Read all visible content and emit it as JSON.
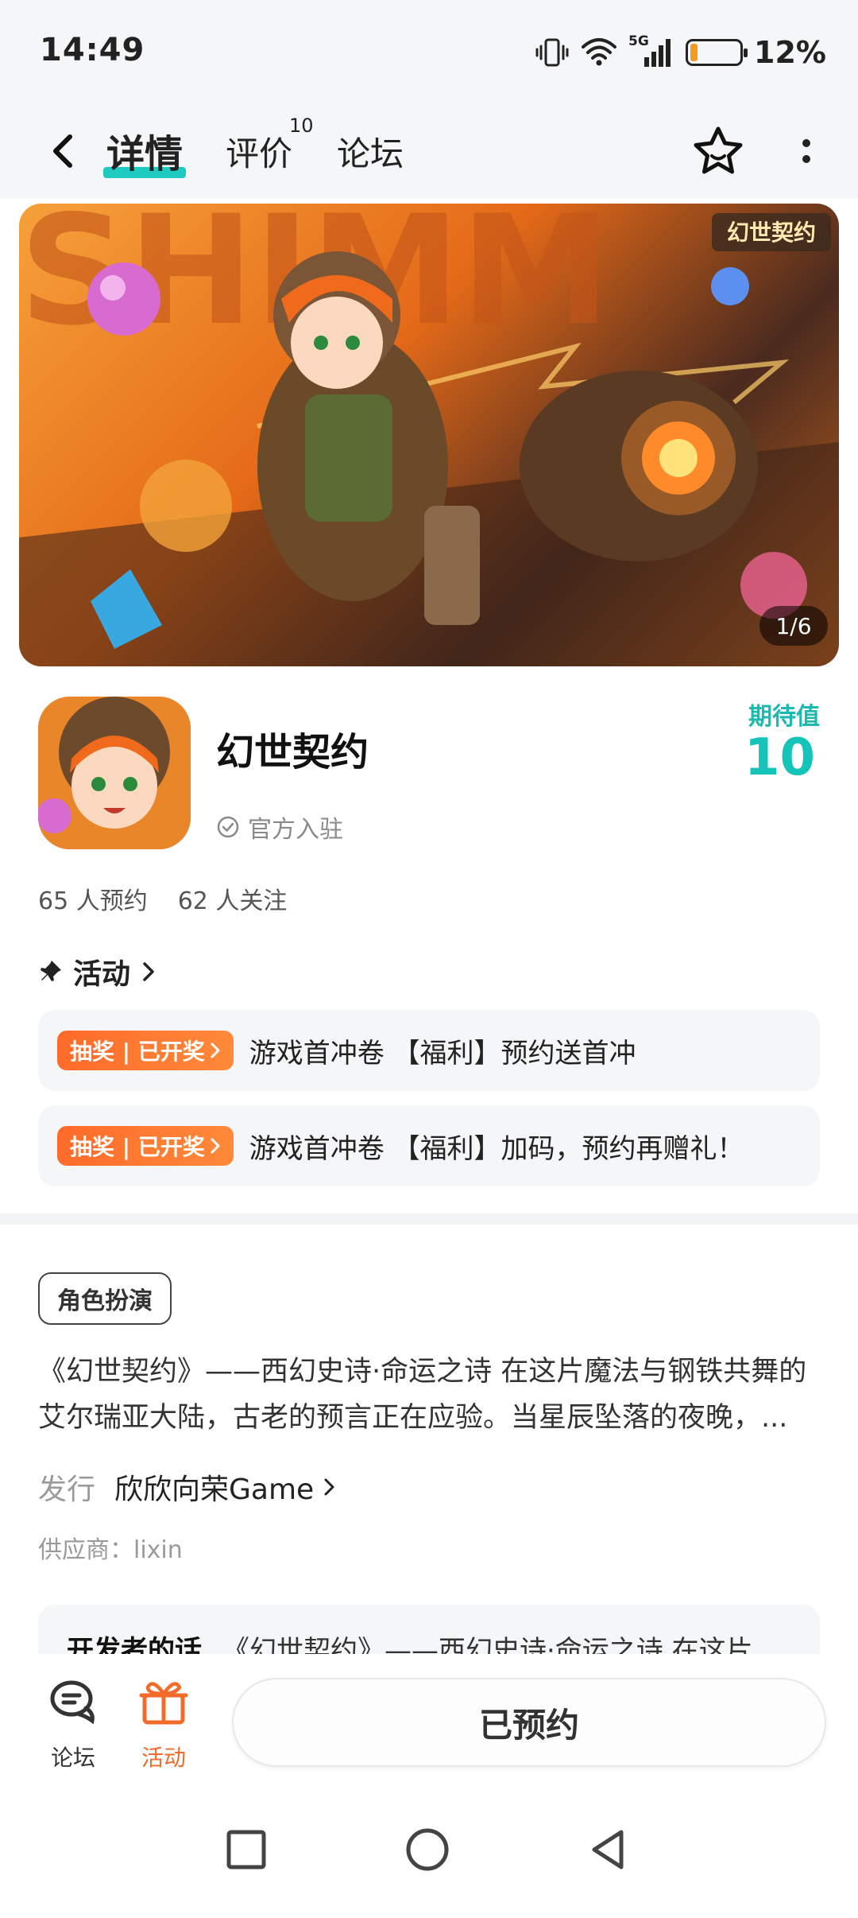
{
  "status_bar": {
    "time": "14:49",
    "network": "5G",
    "battery_percent": "12%",
    "battery_level": 0.12
  },
  "header": {
    "tabs": [
      {
        "label": "详情",
        "active": true
      },
      {
        "label": "评价",
        "badge": "10"
      },
      {
        "label": "论坛"
      }
    ],
    "icons": [
      "back-arrow-icon",
      "star-outline-icon",
      "more-vertical-icon"
    ]
  },
  "banner": {
    "counter": "1/6",
    "logo_text": "幻世契约"
  },
  "app": {
    "name": "幻世契约",
    "verified_label": "官方入驻",
    "expect_label": "期待值",
    "expect_value": "10"
  },
  "stats": {
    "reservations": "65 人预约",
    "followers": "62 人关注"
  },
  "activities": {
    "title": "活动",
    "items": [
      {
        "badge": "抽奖 | 已开奖",
        "text": "游戏首冲卷 【福利】预约送首冲"
      },
      {
        "badge": "抽奖 | 已开奖",
        "text": "游戏首冲卷 【福利】加码，预约再赠礼！"
      }
    ]
  },
  "info": {
    "genre": "角色扮演",
    "description_line1": "《幻世契约》——西幻史诗·命运之诗 在这片魔法与钢铁共舞的",
    "description_line2": "艾尔瑞亚大陆，古老的预言正在应验。当星辰坠落的夜晚，...",
    "publisher_label": "发行",
    "publisher_value": "欣欣向荣Game",
    "supplier": "供应商：lixin"
  },
  "developer": {
    "label": "开发者的话",
    "text": "《幻世契约》——西幻史诗·命运之诗 在这片"
  },
  "bottom_bar": {
    "forum_label": "论坛",
    "activity_label": "活动",
    "reserve_label": "已预约"
  },
  "colors": {
    "accent": "#15c4b8",
    "badge_orange": "#ff6a2a",
    "activity_orange": "#f26b2a"
  }
}
